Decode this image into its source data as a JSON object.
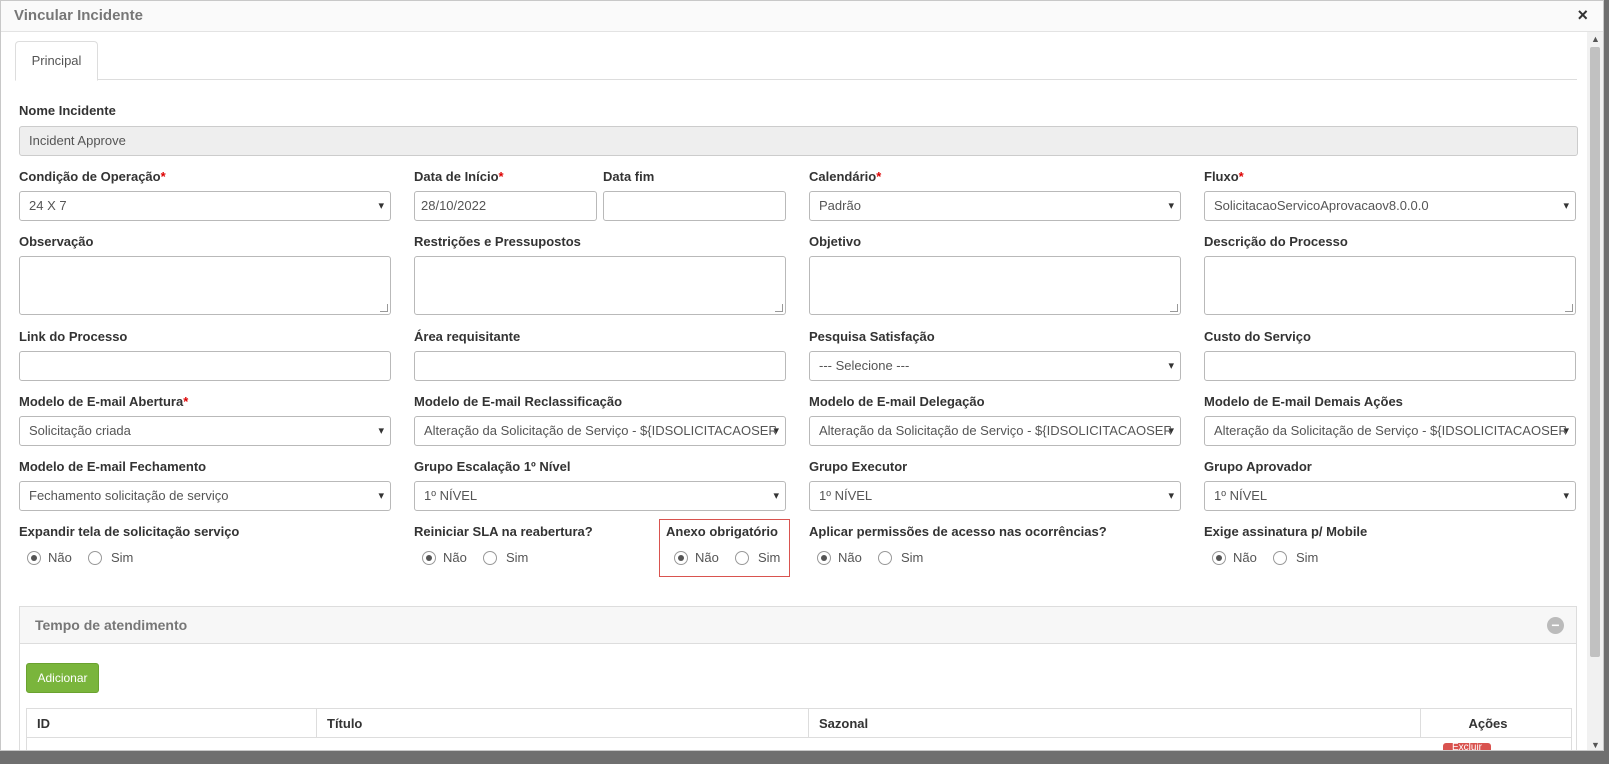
{
  "modal": {
    "title": "Vincular Incidente",
    "close": "×"
  },
  "tabs": [
    {
      "label": "Principal"
    }
  ],
  "fields": {
    "nome_incidente": {
      "label": "Nome Incidente",
      "value": "Incident Approve"
    },
    "condicao": {
      "label": "Condição de Operação",
      "required": "*",
      "value": "24 X 7"
    },
    "data_inicio": {
      "label": "Data de Início",
      "required": "*",
      "value": "28/10/2022"
    },
    "data_fim": {
      "label": "Data fim",
      "value": ""
    },
    "calendario": {
      "label": "Calendário",
      "required": "*",
      "value": "Padrão"
    },
    "fluxo": {
      "label": "Fluxo",
      "required": "*",
      "value": "SolicitacaoServicoAprovacaov8.0.0.0"
    },
    "observacao": {
      "label": "Observação"
    },
    "restricoes": {
      "label": "Restrições e Pressupostos"
    },
    "objetivo": {
      "label": "Objetivo"
    },
    "descricao": {
      "label": "Descrição do Processo"
    },
    "link": {
      "label": "Link do Processo",
      "value": ""
    },
    "area": {
      "label": "Área requisitante",
      "value": ""
    },
    "pesquisa": {
      "label": "Pesquisa Satisfação",
      "value": "--- Selecione ---"
    },
    "custo": {
      "label": "Custo do Serviço",
      "value": ""
    },
    "email_abertura": {
      "label": "Modelo de E-mail Abertura",
      "required": "*",
      "value": "Solicitação criada"
    },
    "email_reclass": {
      "label": "Modelo de E-mail Reclassificação",
      "value": "Alteração da Solicitação de Serviço - ${IDSOLICITACAOSERVICO}"
    },
    "email_delegacao": {
      "label": "Modelo de E-mail Delegação",
      "value": "Alteração da Solicitação de Serviço - ${IDSOLICITACAOSERVICO}"
    },
    "email_demais": {
      "label": "Modelo de E-mail Demais Ações",
      "value": "Alteração da Solicitação de Serviço - ${IDSOLICITACAOSERVICO}"
    },
    "email_fechamento": {
      "label": "Modelo de E-mail Fechamento",
      "value": "Fechamento solicitação de serviço"
    },
    "grupo_escalacao": {
      "label": "Grupo Escalação 1º Nível",
      "value": "1º NÍVEL"
    },
    "grupo_executor": {
      "label": "Grupo Executor",
      "value": "1º NÍVEL"
    },
    "grupo_aprovador": {
      "label": "Grupo Aprovador",
      "value": "1º NÍVEL"
    }
  },
  "radios": {
    "no": "Não",
    "yes": "Sim",
    "expandir": {
      "label": "Expandir tela de solicitação serviço",
      "selected": "Não"
    },
    "reiniciar": {
      "label": "Reiniciar SLA na reabertura?",
      "selected": "Não"
    },
    "anexo": {
      "label": "Anexo obrigatório",
      "selected": "Não"
    },
    "permissoes": {
      "label": "Aplicar permissões de acesso nas ocorrências?",
      "selected": "Não"
    },
    "assinatura": {
      "label": "Exige assinatura p/ Mobile",
      "selected": "Não"
    }
  },
  "panel": {
    "title": "Tempo de atendimento",
    "collapse": "−",
    "add_label": "Adicionar",
    "columns": [
      "ID",
      "Título",
      "Sazonal",
      "Ações"
    ],
    "delete_label": "Excluir"
  },
  "colors": {
    "accent_green": "#7ab53c",
    "danger": "#d9534f"
  }
}
